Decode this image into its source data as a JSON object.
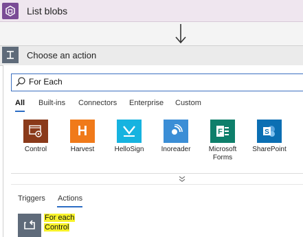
{
  "step": {
    "title": "List blobs",
    "icon": "blob-storage-icon",
    "color": "#7a4c96"
  },
  "action": {
    "title": "Choose an action",
    "icon": "action-icon"
  },
  "search": {
    "value": "For Each"
  },
  "tabs": [
    "All",
    "Built-ins",
    "Connectors",
    "Enterprise",
    "Custom"
  ],
  "connectors": [
    {
      "label": "Control",
      "icon": "control-icon",
      "color": "#8a3a1a"
    },
    {
      "label": "Harvest",
      "icon": "harvest-icon",
      "color": "#f07a1a"
    },
    {
      "label": "HelloSign",
      "icon": "hellosign-icon",
      "color": "#16b3e0"
    },
    {
      "label": "Inoreader",
      "icon": "inoreader-icon",
      "color": "#3b8ed6"
    },
    {
      "label": "Microsoft Forms",
      "icon": "forms-icon",
      "color": "#0e7f6b"
    },
    {
      "label": "SharePoint",
      "icon": "sharepoint-icon",
      "color": "#0b6fb3"
    }
  ],
  "subtabs": [
    "Triggers",
    "Actions"
  ],
  "result": {
    "title": "For each",
    "subtitle": "Control",
    "icon": "loop-icon",
    "highlight": "#f7f22a"
  }
}
